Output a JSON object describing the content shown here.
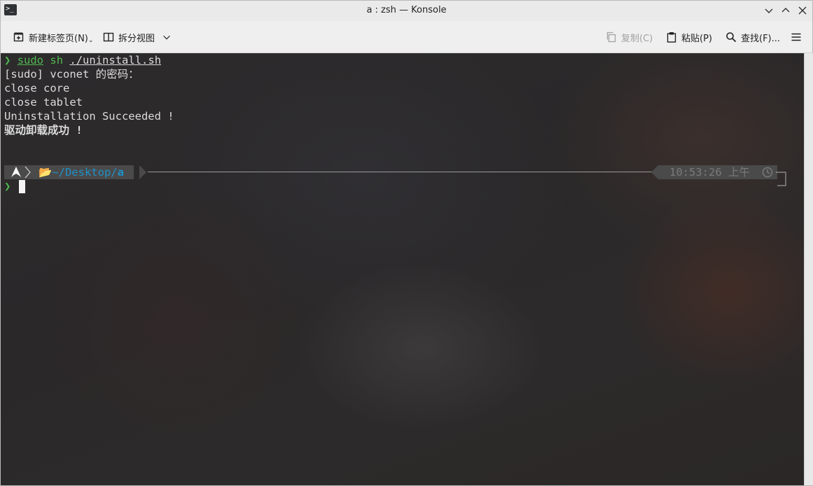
{
  "window": {
    "title": "a : zsh — Konsole"
  },
  "toolbar": {
    "new_tab": "新建标签页(N)",
    "split_view": "拆分视图",
    "copy": "复制(C)",
    "paste": "粘贴(P)",
    "find": "查找(F)..."
  },
  "terminal": {
    "prompt_symbol": "❯",
    "cmd_sudo": "sudo",
    "cmd_sh": "sh",
    "cmd_script": "./uninstall.sh",
    "output": [
      "[sudo] vconet 的密码：",
      "close core",
      "close tablet",
      "Uninstallation Succeeded !",
      "驱动卸载成功 !"
    ],
    "prompt_dir_prefix": "~/Desktop/",
    "prompt_dir_current": "a",
    "prompt_time": "10:53:26 上午"
  },
  "colors": {
    "prompt_green": "#4fb84f",
    "dir_blue": "#1e90c8",
    "segment_bg": "#4a4a4a"
  }
}
